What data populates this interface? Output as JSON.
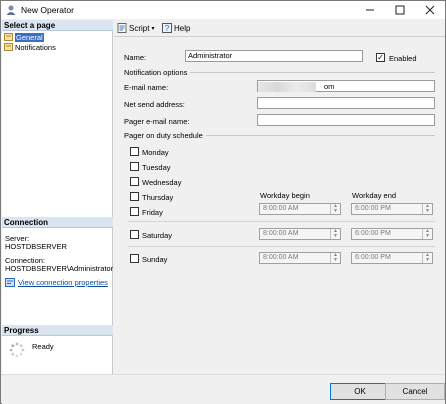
{
  "window": {
    "title": "New Operator"
  },
  "left": {
    "select_page_header": "Select a page",
    "pages": [
      "General",
      "Notifications"
    ],
    "connection_header": "Connection",
    "server_label": "Server:",
    "server_value": "HOSTDBSERVER",
    "connection_label": "Connection:",
    "connection_value": "HOSTDBSERVER\\Administrator",
    "view_props_link": "View connection properties",
    "progress_header": "Progress",
    "progress_status": "Ready"
  },
  "toolbar": {
    "script_label": "Script",
    "help_label": "Help"
  },
  "form": {
    "name_label": "Name:",
    "name_value": "Administrator",
    "enabled_label": "Enabled",
    "enabled_checked": true,
    "notification_section": "Notification options",
    "email_label": "E-mail name:",
    "email_value_visible": "om",
    "netsend_label": "Net send address:",
    "pager_email_label": "Pager e-mail name:",
    "pager_schedule_section": "Pager on duty schedule",
    "days": [
      "Monday",
      "Tuesday",
      "Wednesday",
      "Thursday",
      "Friday"
    ],
    "saturday": "Saturday",
    "sunday": "Sunday",
    "workday_begin_label": "Workday begin",
    "workday_end_label": "Workday end",
    "times": {
      "weekday_begin": "8:00:00 AM",
      "weekday_end": "6:00:00 PM",
      "saturday_begin": "8:00:00 AM",
      "saturday_end": "6:00:00 PM",
      "sunday_begin": "8:00:00 AM",
      "sunday_end": "6:00:00 PM"
    }
  },
  "buttons": {
    "ok": "OK",
    "cancel": "Cancel"
  }
}
